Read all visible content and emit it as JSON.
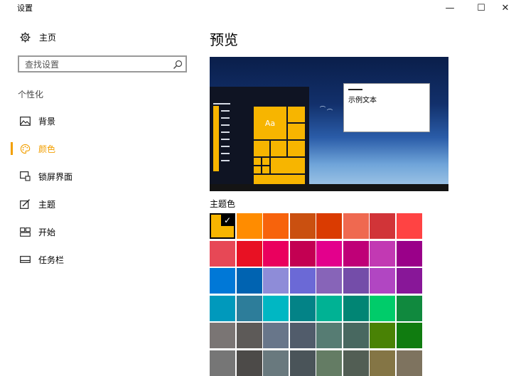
{
  "window": {
    "title": "设置",
    "min": "—",
    "max": "☐",
    "close": "✕"
  },
  "sidebar": {
    "home": "主页",
    "search_placeholder": "查找设置",
    "section": "个性化",
    "items": [
      {
        "label": "背景",
        "icon": "image-icon"
      },
      {
        "label": "颜色",
        "icon": "palette-icon",
        "active": true
      },
      {
        "label": "锁屏界面",
        "icon": "lock-screen-icon"
      },
      {
        "label": "主题",
        "icon": "theme-icon"
      },
      {
        "label": "开始",
        "icon": "start-icon"
      },
      {
        "label": "任务栏",
        "icon": "taskbar-icon"
      }
    ]
  },
  "main": {
    "preview_title": "预览",
    "preview": {
      "tile_text": "Aa",
      "sample_text": "示例文本"
    },
    "accent_label": "主题色",
    "accent_colors": [
      [
        "#f7b500",
        "#ff8c00",
        "#f7630c",
        "#ca5010",
        "#da3b01",
        "#ef6950",
        "#d13438",
        "#ff4343"
      ],
      [
        "#e74856",
        "#e81123",
        "#ea005e",
        "#c30052",
        "#e3008c",
        "#bf0077",
        "#c239b3",
        "#9a0089"
      ],
      [
        "#0078d7",
        "#0063b1",
        "#8e8cd8",
        "#6b69d6",
        "#8764b8",
        "#744da9",
        "#b146c2",
        "#881798"
      ],
      [
        "#0099bc",
        "#2d7d9a",
        "#00b7c3",
        "#038387",
        "#00b294",
        "#018574",
        "#00cc6a",
        "#10893e"
      ],
      [
        "#7a7574",
        "#5d5a58",
        "#68768a",
        "#515c6b",
        "#567c73",
        "#486860",
        "#498205",
        "#107c10"
      ],
      [
        "#767676",
        "#4c4a48",
        "#69797e",
        "#4a5459",
        "#647c64",
        "#525e54",
        "#847545",
        "#7e735f"
      ]
    ],
    "selected_accent": "#f7b500"
  }
}
